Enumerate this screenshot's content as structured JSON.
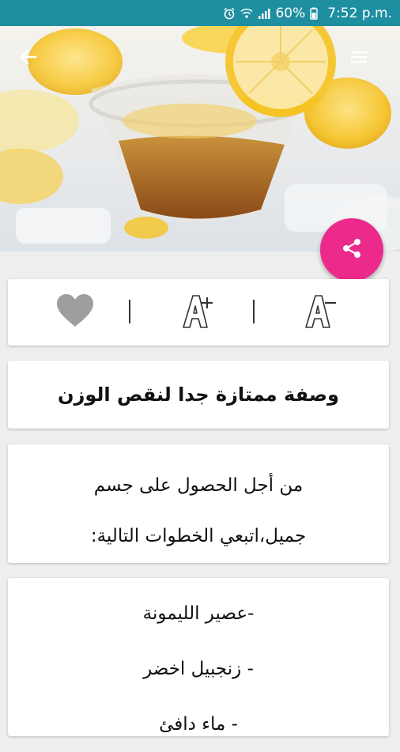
{
  "status_bar": {
    "battery_percent": "60%",
    "time": "7:52 p.m.",
    "color": "#1e8fa0"
  },
  "toolbar": {
    "favorite_icon": "heart-icon",
    "font_increase_icon": "font-increase-icon",
    "font_decrease_icon": "font-decrease-icon"
  },
  "share_button": {
    "icon": "share-icon",
    "color": "#ec2a8c"
  },
  "article": {
    "title": "وصفة ممتازة جدا لنقص الوزن",
    "intro_line1": "من أجل الحصول على جسم",
    "intro_line2": "جميل،اتبعي الخطوات التالية:",
    "steps": [
      "-عصير الليمونة",
      "- زنجبيل اخضر",
      "- ماء دافئ"
    ]
  }
}
